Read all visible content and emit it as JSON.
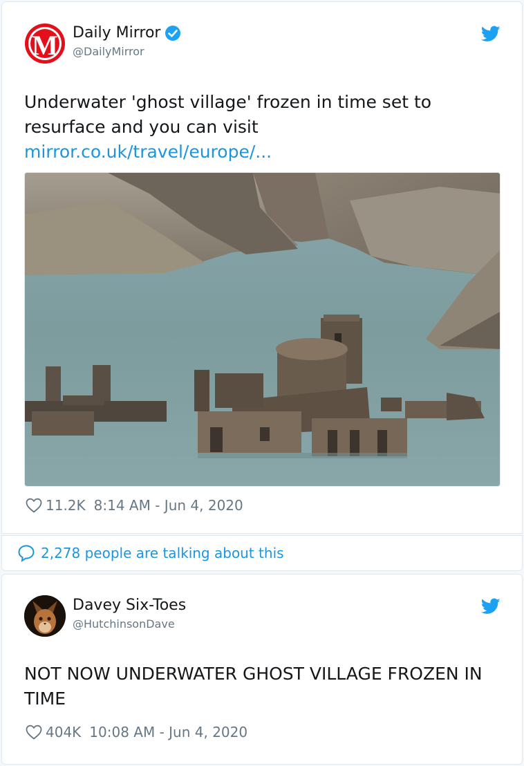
{
  "tweet1": {
    "author": {
      "name": "Daily Mirror",
      "handle": "@DailyMirror",
      "avatar_letter": "M",
      "verified": true
    },
    "text_line1": "Underwater 'ghost village' frozen in time set to",
    "text_line2": "resurface and you can visit",
    "link": "mirror.co.uk/travel/europe/...",
    "likes": "11.2K",
    "timestamp": "8:14 AM - Jun 4, 2020",
    "talking": "2,278 people are talking about this"
  },
  "tweet2": {
    "author": {
      "name": "Davey Six-Toes",
      "handle": "@HutchinsonDave"
    },
    "text_line1": "NOT NOW UNDERWATER GHOST VILLAGE FROZEN IN",
    "text_line2": "TIME",
    "likes": "404K",
    "timestamp": "10:08 AM - Jun 4, 2020"
  },
  "colors": {
    "link": "#1b95e0",
    "muted": "#657786",
    "mirror_red": "#e3101b",
    "twitter_blue": "#1da1f2"
  },
  "icons": {
    "bird": "twitter-bird-icon",
    "heart": "heart-outline-icon",
    "bubble": "speech-bubble-icon",
    "verified": "verified-badge-icon"
  }
}
